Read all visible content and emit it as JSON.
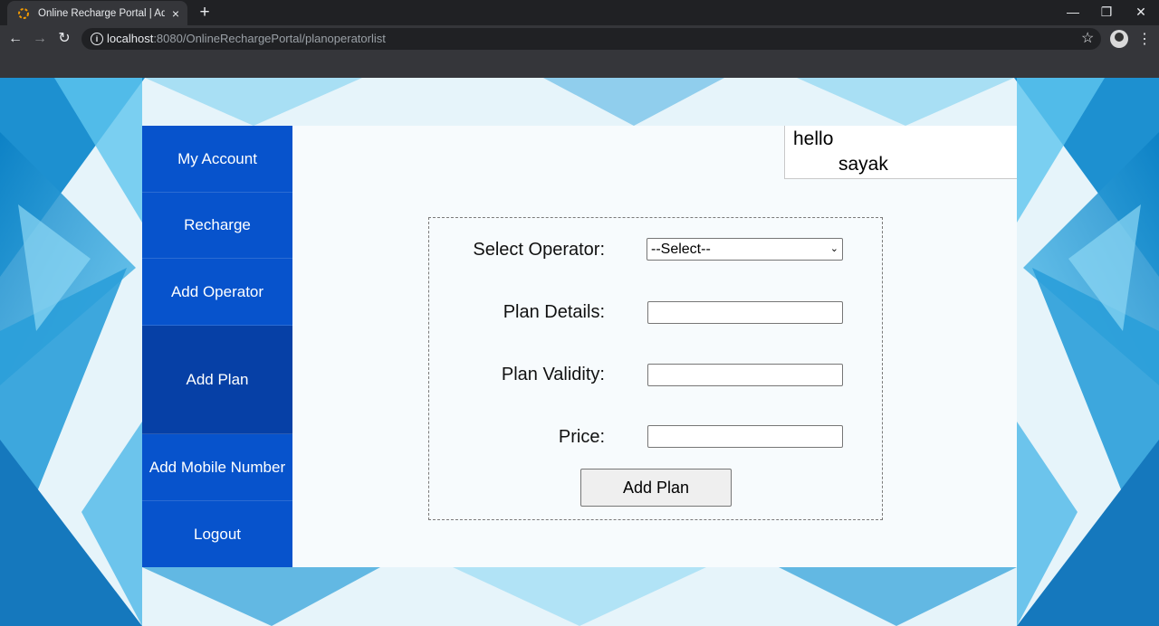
{
  "browser": {
    "tab_title": "Online Recharge Portal | Add Plan",
    "url_host": "localhost",
    "url_path": ":8080/OnlineRechargePortal/planoperatorlist",
    "new_tab_symbol": "+",
    "close_symbol": "×",
    "back_symbol": "←",
    "forward_symbol": "→",
    "reload_symbol": "↻",
    "star_symbol": "☆",
    "menu_symbol": "⋮",
    "minimize_symbol": "—",
    "maximize_symbol": "❐",
    "window_close_symbol": "✕"
  },
  "sidebar": {
    "items": [
      {
        "label": "My Account"
      },
      {
        "label": "Recharge"
      },
      {
        "label": "Add Operator"
      },
      {
        "label": "Add Plan",
        "active": true
      },
      {
        "label": "Add Mobile Number"
      },
      {
        "label": "Logout"
      }
    ]
  },
  "greeting": {
    "hello": "hello",
    "user": "sayak"
  },
  "form": {
    "operator_label": "Select Operator:",
    "operator_selected": "--Select--",
    "details_label": "Plan Details:",
    "details_value": "",
    "validity_label": "Plan Validity:",
    "validity_value": "",
    "price_label": "Price:",
    "price_value": "",
    "submit_label": "Add Plan"
  },
  "colors": {
    "sidebar": "#0753cc",
    "sidebar_active": "#0640a6",
    "browser_dark": "#202124",
    "browser_toolbar": "#35363a"
  }
}
